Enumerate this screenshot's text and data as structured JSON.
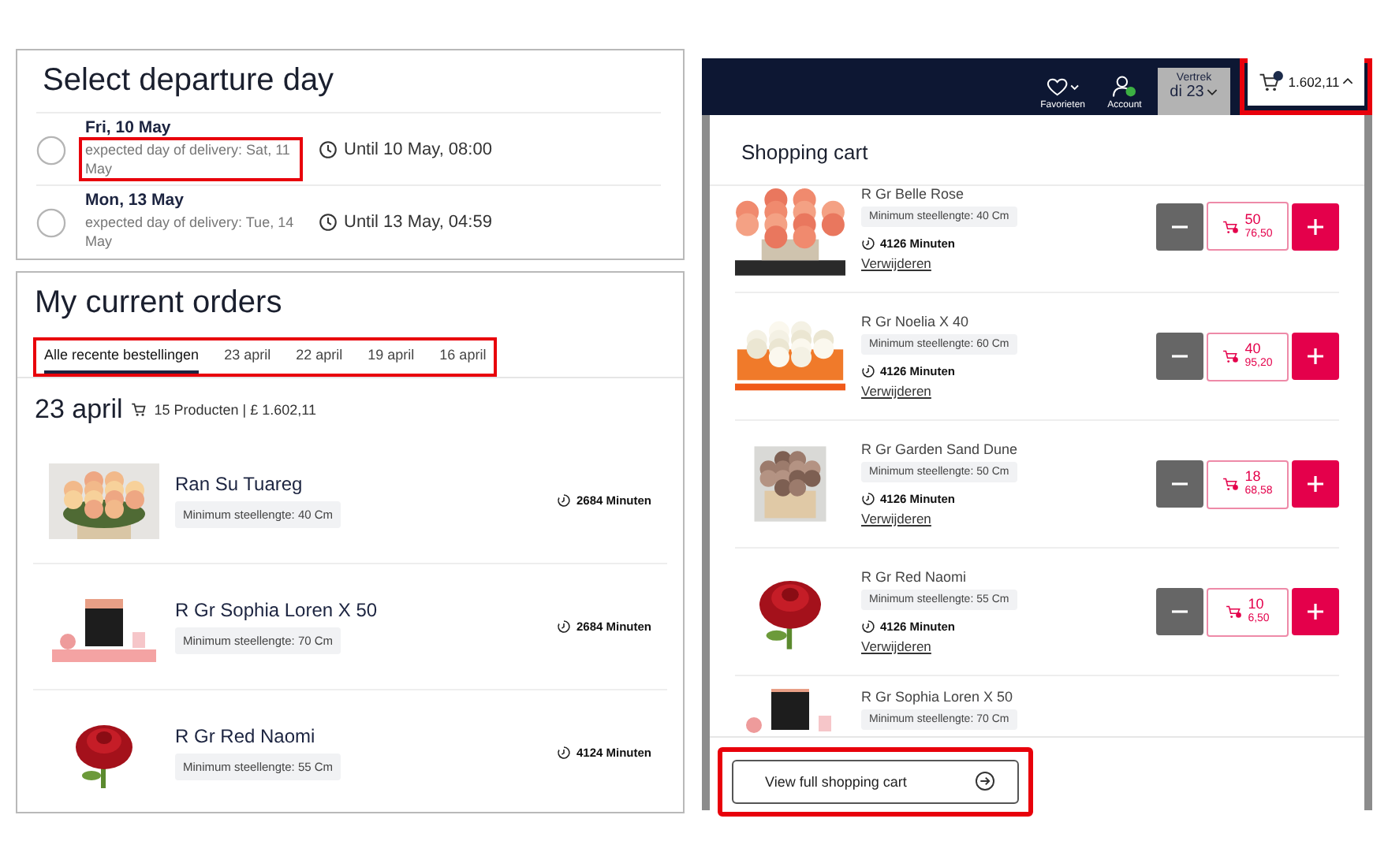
{
  "departure": {
    "title": "Select departure day",
    "options": [
      {
        "day": "Fri, 10 May",
        "delivery": "expected day of delivery: Sat, 11 May",
        "deadline": "Until 10 May, 08:00",
        "selected": false,
        "highlighted": true
      },
      {
        "day": "Mon, 13 May",
        "delivery": "expected day of delivery: Tue, 14 May",
        "deadline": "Until 13 May, 04:59",
        "selected": false,
        "highlighted": false
      }
    ]
  },
  "orders": {
    "title": "My current orders",
    "tabs_highlighted": true,
    "tabs": [
      {
        "label": "Alle recente bestellingen",
        "selected": true
      },
      {
        "label": "23 april",
        "selected": false
      },
      {
        "label": "22 april",
        "selected": false
      },
      {
        "label": "19 april",
        "selected": false
      },
      {
        "label": "16 april",
        "selected": false
      }
    ],
    "group": {
      "date": "23 april",
      "summary": "15 Producten | £ 1.602,11"
    },
    "items": [
      {
        "name": "Ran Su Tuareg",
        "tag": "Minimum steellengte: 40 Cm",
        "time": "2684 Minuten"
      },
      {
        "name": "R Gr Sophia Loren X 50",
        "tag": "Minimum steellengte: 70 Cm",
        "time": "2684 Minuten"
      },
      {
        "name": "R Gr Red Naomi",
        "tag": "Minimum steellengte: 55 Cm",
        "time": "4124 Minuten"
      }
    ]
  },
  "header": {
    "favorites": "Favorieten",
    "account": "Account",
    "account_online": true,
    "departure_label": "Vertrek",
    "departure_value": "di 23",
    "cart_total": "1.602,11",
    "cart_highlighted": true
  },
  "cart": {
    "title": "Shopping cart",
    "items": [
      {
        "name": "R Gr Belle Rose",
        "tag": "Minimum steellengte: 40 Cm",
        "time": "4126 Minuten",
        "remove": "Verwijderen",
        "quantity": "50",
        "price": "76,50"
      },
      {
        "name": "R Gr Noelia X 40",
        "tag": "Minimum steellengte: 60 Cm",
        "time": "4126 Minuten",
        "remove": "Verwijderen",
        "quantity": "40",
        "price": "95,20"
      },
      {
        "name": "R Gr Garden Sand Dune",
        "tag": "Minimum steellengte: 50 Cm",
        "time": "4126 Minuten",
        "remove": "Verwijderen",
        "quantity": "18",
        "price": "68,58"
      },
      {
        "name": "R Gr Red Naomi",
        "tag": "Minimum steellengte: 55 Cm",
        "time": "4126 Minuten",
        "remove": "Verwijderen",
        "quantity": "10",
        "price": "6,50"
      },
      {
        "name": "R Gr Sophia Loren X 50",
        "tag": "Minimum steellengte: 70 Cm"
      }
    ],
    "view_button": {
      "label": "View full shopping cart",
      "highlighted": true
    }
  }
}
